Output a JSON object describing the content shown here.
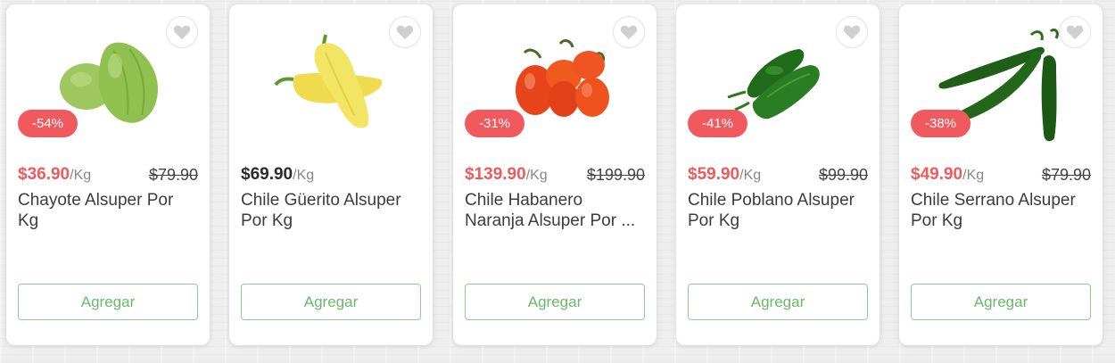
{
  "products": [
    {
      "name": "Chayote Alsuper Por Kg",
      "price": "$36.90",
      "unit": "/Kg",
      "old_price": "$79.90",
      "discount": "-54%",
      "button": "Agregar",
      "image": "chayote-image"
    },
    {
      "name": "Chile Güerito Alsuper Por Kg",
      "price": "$69.90",
      "unit": "/Kg",
      "old_price": "",
      "discount": "",
      "button": "Agregar",
      "image": "chile-guerito-image"
    },
    {
      "name": "Chile Habanero Naranja Alsuper Por ...",
      "price": "$139.90",
      "unit": "/Kg",
      "old_price": "$199.90",
      "discount": "-31%",
      "button": "Agregar",
      "image": "chile-habanero-image"
    },
    {
      "name": "Chile Poblano Alsuper Por Kg",
      "price": "$59.90",
      "unit": "/Kg",
      "old_price": "$99.90",
      "discount": "-41%",
      "button": "Agregar",
      "image": "chile-poblano-image"
    },
    {
      "name": "Chile Serrano Alsuper Por Kg",
      "price": "$49.90",
      "unit": "/Kg",
      "old_price": "$79.90",
      "discount": "-38%",
      "button": "Agregar",
      "image": "chile-serrano-image"
    }
  ],
  "colors": {
    "sale_price": "#ef5a5c",
    "badge": "#f05a5f",
    "button": "#67bb67",
    "regular_price": "#2b2b2b"
  }
}
